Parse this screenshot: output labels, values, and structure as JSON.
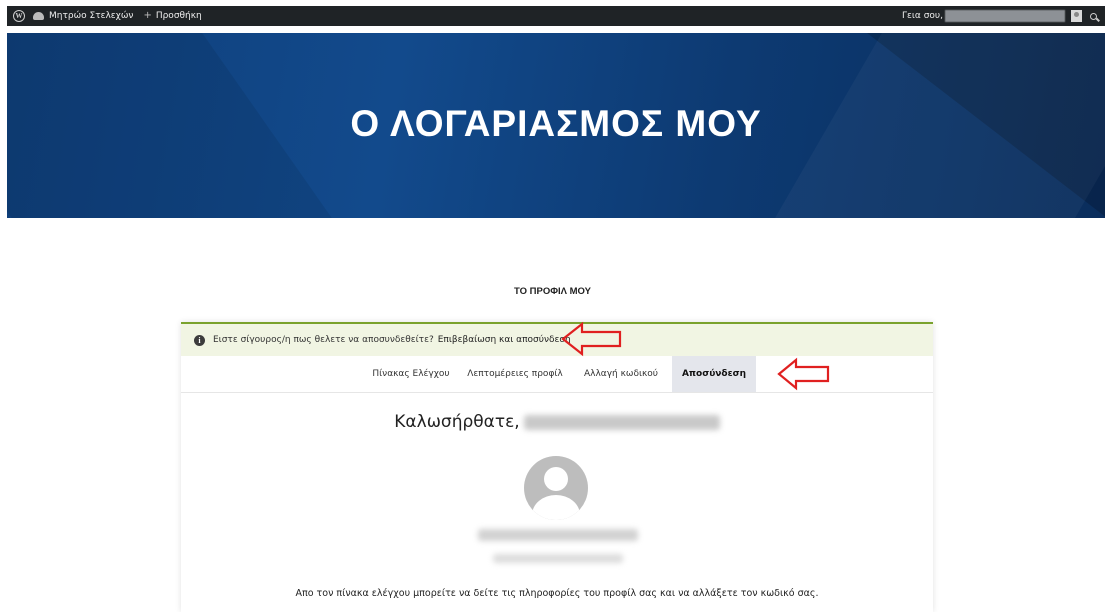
{
  "admin_bar": {
    "site_name": "Μητρώο Στελεχών",
    "new_label": "Προσθήκη",
    "greeting": "Γεια σου,"
  },
  "hero": {
    "title": "Ο ΛΟΓΑΡΙΑΣΜΟΣ ΜΟΥ"
  },
  "profile": {
    "section_title": "ΤΟ ΠΡΟΦΙΛ ΜΟΥ",
    "notice_text": "Ειστε σίγουρος/η πως θελετε να αποσυνδεθείτε?",
    "notice_link": "Επιβεβαίωση και αποσύνδεση",
    "tabs": [
      {
        "label": "Πίνακας Ελέγχου",
        "active": false
      },
      {
        "label": "Λεπτομέρειες προφίλ",
        "active": false
      },
      {
        "label": "Αλλαγή κωδικού",
        "active": false
      },
      {
        "label": "Αποσύνδεση",
        "active": true
      }
    ],
    "welcome": "Καλωσήρθατε,",
    "description": "Απο τον πίνακα ελέγχου μπορείτε να δείτε τις πληροφορίες του προφίλ σας και να αλλάξετε τον κωδικό σας."
  },
  "colors": {
    "admin_bar": "#1f2326",
    "hero_blue": "#124a8c",
    "notice_bg": "#f1f5e3",
    "notice_border": "#7aa22d",
    "active_tab": "#e4e6ec",
    "annotation_arrow": "#e02020"
  },
  "icons": {
    "wp_logo": "wordpress-logo-icon",
    "site": "dashboard-icon",
    "new": "plus-icon",
    "search": "search-icon",
    "notice": "info-icon"
  }
}
